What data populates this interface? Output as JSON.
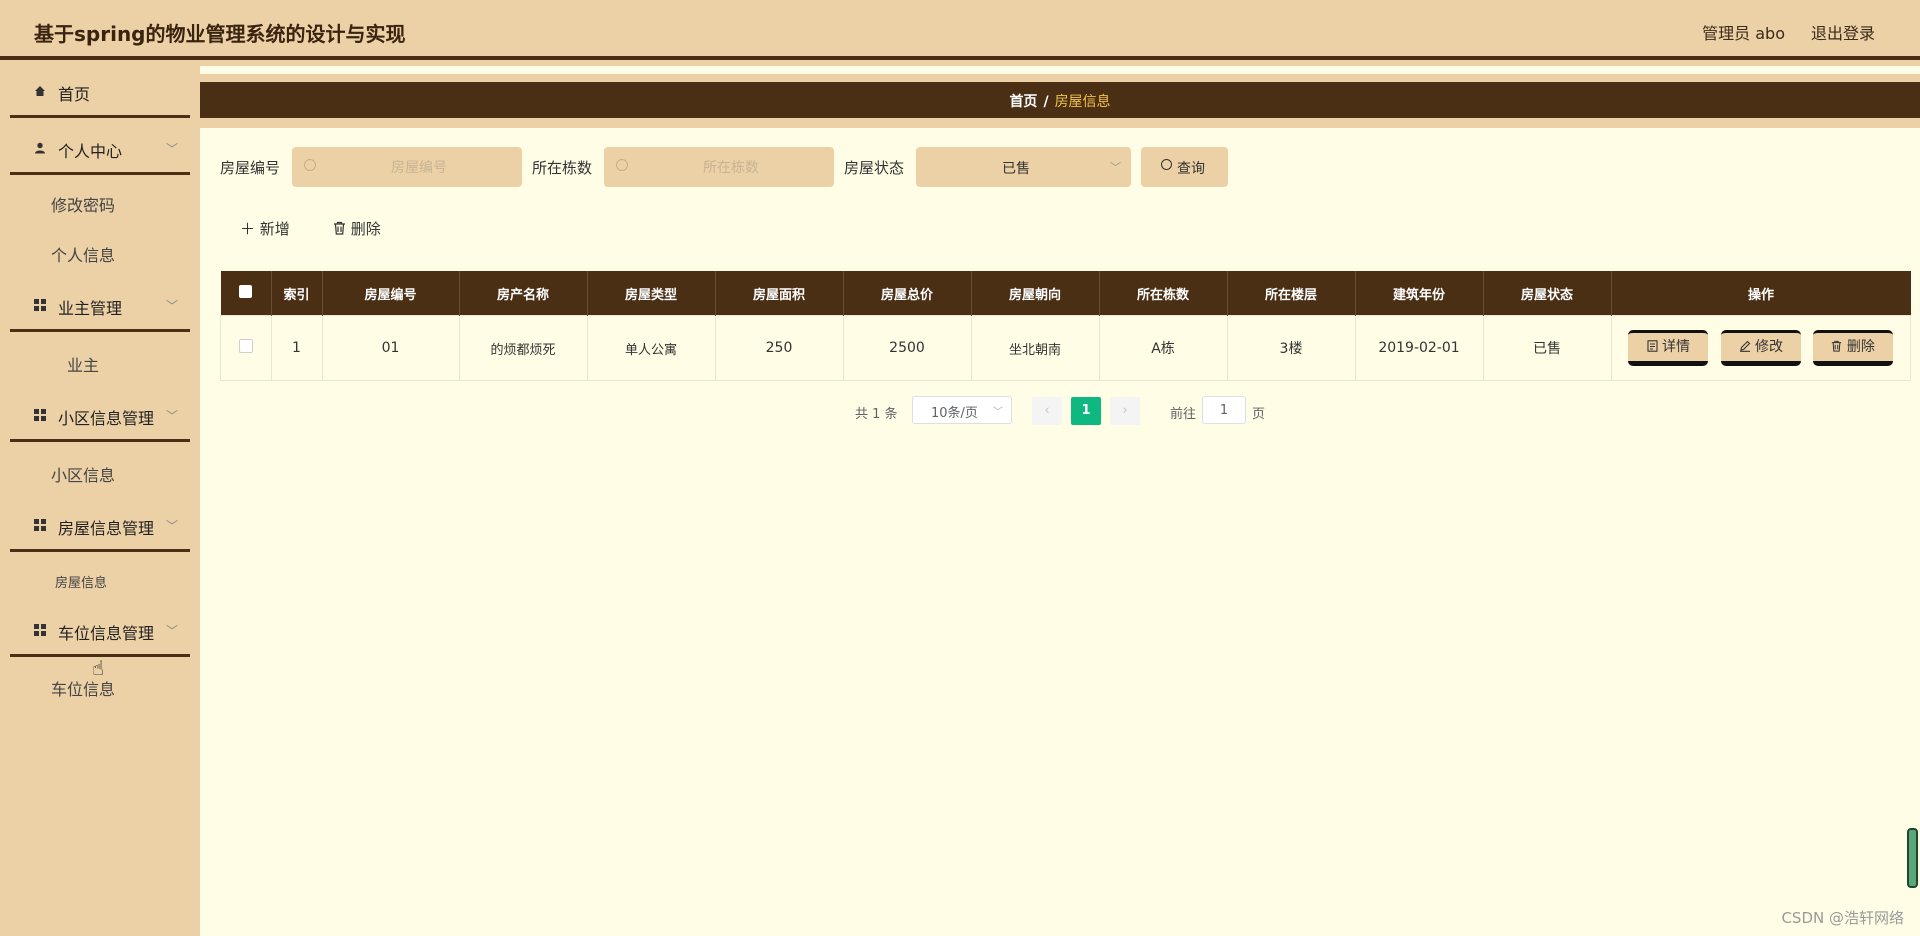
{
  "header": {
    "title": "基于spring的物业管理系统的设计与实现",
    "user": "管理员 abo",
    "logout": "退出登录"
  },
  "sidebar": {
    "items": [
      {
        "label": "首页",
        "icon": "home-icon"
      },
      {
        "label": "个人中心",
        "icon": "user-icon",
        "children": [
          "修改密码",
          "个人信息"
        ]
      },
      {
        "label": "业主管理",
        "icon": "grid-icon",
        "children": [
          "业主"
        ]
      },
      {
        "label": "小区信息管理",
        "icon": "grid-icon",
        "children": [
          "小区信息"
        ]
      },
      {
        "label": "房屋信息管理",
        "icon": "grid-icon",
        "children": [
          "房屋信息"
        ]
      },
      {
        "label": "车位信息管理",
        "icon": "grid-icon",
        "children": [
          "车位信息"
        ]
      }
    ]
  },
  "breadcrumb": {
    "home": "首页",
    "sep": "/",
    "current": "房屋信息"
  },
  "search": {
    "house_no_label": "房屋编号",
    "house_no_placeholder": "房屋编号",
    "building_label": "所在栋数",
    "building_placeholder": "所在栋数",
    "status_label": "房屋状态",
    "status_value": "已售",
    "query_label": "查询"
  },
  "toolbar": {
    "add": "新增",
    "delete": "删除"
  },
  "table": {
    "headers": [
      "索引",
      "房屋编号",
      "房产名称",
      "房屋类型",
      "房屋面积",
      "房屋总价",
      "房屋朝向",
      "所在栋数",
      "所在楼层",
      "建筑年份",
      "房屋状态",
      "操作"
    ],
    "rows": [
      [
        "1",
        "01",
        "的烦都烦死",
        "单人公寓",
        "250",
        "2500",
        "坐北朝南",
        "A栋",
        "3楼",
        "2019-02-01",
        "已售"
      ]
    ],
    "actions": {
      "detail": "详情",
      "edit": "修改",
      "delete": "删除"
    }
  },
  "pagination": {
    "total": "共 1 条",
    "page_size": "10条/页",
    "current": "1",
    "goto": "前往",
    "goto_value": "1",
    "page_suffix": "页"
  },
  "watermark": "CSDN @浩轩网络",
  "colors": {
    "accent": "#4a2f14",
    "sidebar_bg": "#ecd0a6",
    "main_bg": "#fffde6",
    "pager_active": "#10b881",
    "breadcrumb_current": "#f3c34a"
  }
}
